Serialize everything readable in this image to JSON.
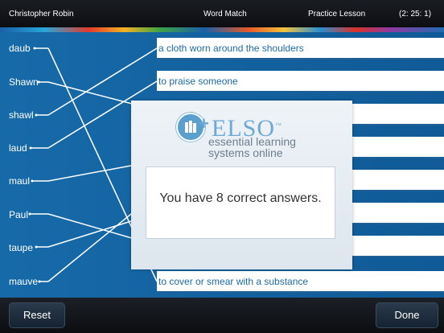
{
  "header": {
    "user_name": "Christopher Robin",
    "activity": "Word Match",
    "lesson_type": "Practice Lesson",
    "timer": "(2: 25: 1)"
  },
  "words": [
    "daub",
    "Shawn",
    "shawl",
    "laud",
    "maul",
    "Paul",
    "taupe",
    "mauve"
  ],
  "definitions": [
    "a cloth worn around the shoulders",
    "to praise someone",
    "",
    "",
    "",
    "",
    "",
    "to cover or smear with a substance"
  ],
  "modal": {
    "logo_text": "ELSO",
    "logo_plus": "+",
    "trademark": "™",
    "tagline_line1": "essential learning",
    "tagline_line2": "systems online",
    "result_message": "You have 8 correct answers."
  },
  "footer": {
    "reset_label": "Reset",
    "done_label": "Done"
  },
  "colors": {
    "background": "#1462a0",
    "definition_text": "#1e6aa3",
    "logo": "#6ea8d6"
  }
}
